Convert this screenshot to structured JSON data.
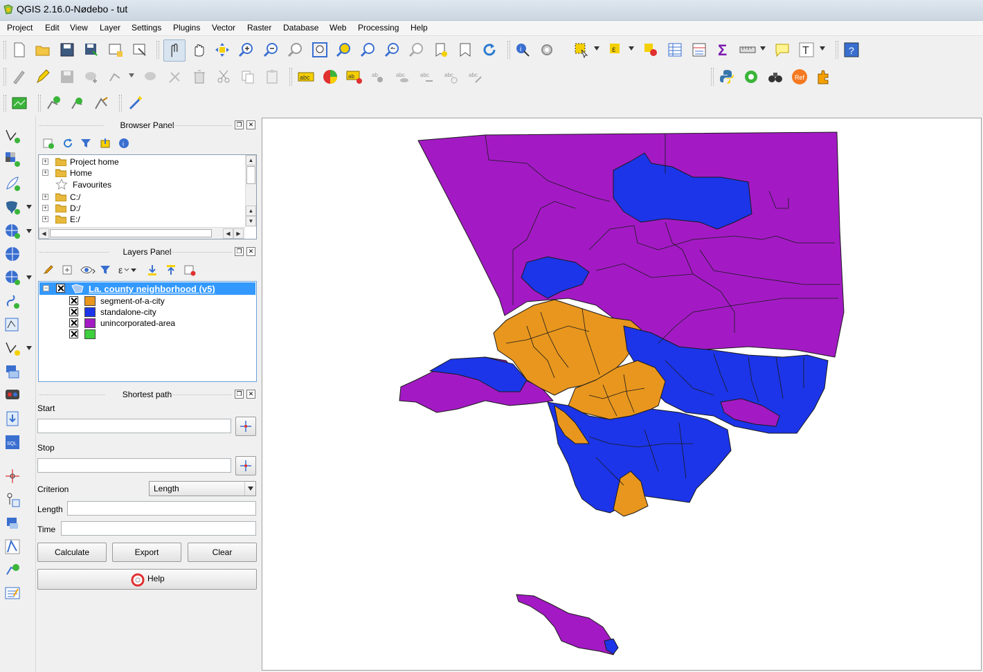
{
  "window": {
    "title": "QGIS 2.16.0-Nødebo - tut"
  },
  "menu": [
    "Project",
    "Edit",
    "View",
    "Layer",
    "Settings",
    "Plugins",
    "Vector",
    "Raster",
    "Database",
    "Web",
    "Processing",
    "Help"
  ],
  "browser_panel": {
    "title": "Browser Panel",
    "items": [
      {
        "label": "Project home",
        "icon": "folder-icon"
      },
      {
        "label": "Home",
        "icon": "folder-icon"
      },
      {
        "label": "Favourites",
        "icon": "star-icon"
      },
      {
        "label": "C:/",
        "icon": "folder-icon"
      },
      {
        "label": "D:/",
        "icon": "folder-icon"
      },
      {
        "label": "E:/",
        "icon": "folder-icon"
      }
    ]
  },
  "layers_panel": {
    "title": "Layers Panel",
    "layer": {
      "name": "La. county neighborhood (v5)",
      "checked": true,
      "categories": [
        {
          "label": "segment-of-a-city",
          "color": "#e8961e"
        },
        {
          "label": "standalone-city",
          "color": "#1c35e8"
        },
        {
          "label": "unincorporated-area",
          "color": "#a31ac4"
        },
        {
          "label": "",
          "color": "#3ecf3e"
        }
      ]
    }
  },
  "shortest_path": {
    "title": "Shortest path",
    "start_label": "Start",
    "stop_label": "Stop",
    "criterion_label": "Criterion",
    "criterion_value": "Length",
    "length_label": "Length",
    "time_label": "Time",
    "calculate": "Calculate",
    "export": "Export",
    "clear": "Clear",
    "help": "Help"
  },
  "map": {
    "colors": {
      "segment": "#e8961e",
      "standalone": "#1c35e8",
      "unincorporated": "#a31ac4"
    }
  }
}
